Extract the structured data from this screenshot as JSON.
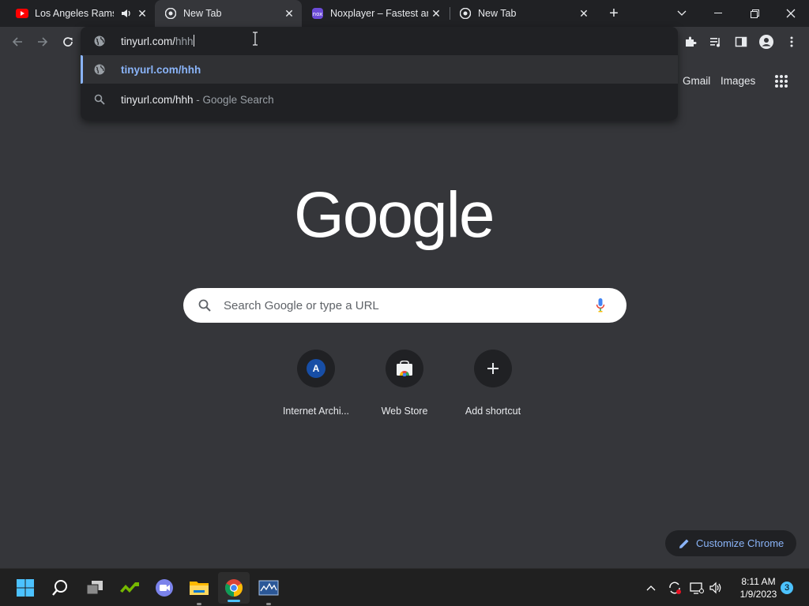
{
  "tabs": [
    {
      "title": "Los Angeles Rams",
      "favicon": "youtube-icon",
      "audio": true
    },
    {
      "title": "New Tab",
      "favicon": "chrome-icon",
      "active": true
    },
    {
      "title": "Noxplayer – Fastest an",
      "favicon": "noxplayer-icon"
    },
    {
      "title": "New Tab",
      "favicon": "chrome-icon"
    }
  ],
  "omnibox": {
    "typed": "tinyurl.com/",
    "autocomplete": "hhh",
    "suggestions": [
      {
        "text": "tinyurl.com/hhh",
        "icon": "globe-icon"
      },
      {
        "query": "tinyurl.com/hhh",
        "suffix": " - Google Search",
        "icon": "search-icon"
      }
    ]
  },
  "header_links": {
    "gmail": "Gmail",
    "images": "Images"
  },
  "logo": "Google",
  "search": {
    "placeholder": "Search Google or type a URL"
  },
  "shortcuts": [
    {
      "label": "Internet Archi...",
      "letter": "A"
    },
    {
      "label": "Web Store"
    },
    {
      "label": "Add shortcut"
    }
  ],
  "customize": {
    "label": "Customize Chrome"
  },
  "clock": {
    "time": "8:11 AM",
    "date": "1/9/2023"
  },
  "notifications": {
    "count": "3"
  },
  "colors": {
    "accent": "#8ab4f8",
    "page_bg": "#35363a",
    "tabstrip_bg": "#202124",
    "taskbar_bg": "#202020"
  }
}
